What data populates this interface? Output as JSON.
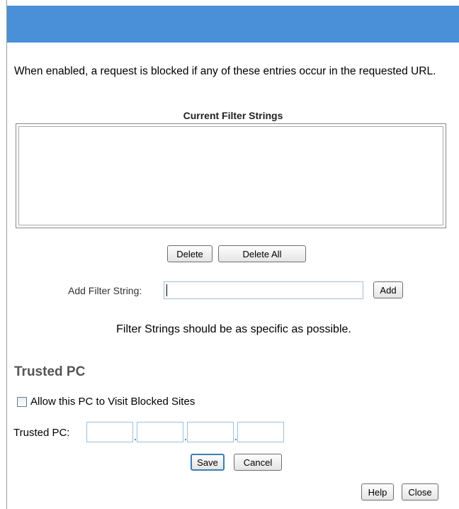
{
  "intro": {
    "text": "When enabled, a request is blocked if any of these entries occur in the requested URL."
  },
  "filter_list": {
    "title": "Current Filter Strings",
    "items": []
  },
  "list_actions": {
    "delete_label": "Delete",
    "delete_all_label": "Delete All"
  },
  "add_filter": {
    "label": "Add Filter String:",
    "value": "",
    "add_label": "Add"
  },
  "hint": "Filter Strings should be as specific as possible.",
  "trusted_pc": {
    "section_title": "Trusted PC",
    "checkbox_label": "Allow this PC to Visit Blocked Sites",
    "checked": false,
    "field_label": "Trusted PC:",
    "octets": [
      "",
      "",
      "",
      ""
    ]
  },
  "form_actions": {
    "save_label": "Save",
    "cancel_label": "Cancel"
  },
  "footer": {
    "help_label": "Help",
    "close_label": "Close"
  },
  "colors": {
    "header": "#4a90d9",
    "section_title": "#555555",
    "input_border": "#9cc0dc"
  }
}
